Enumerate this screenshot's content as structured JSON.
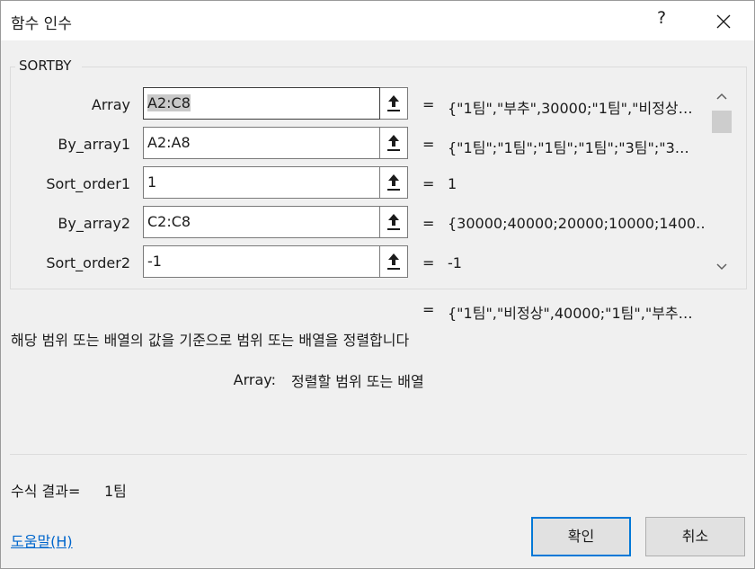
{
  "window": {
    "title": "함수 인수",
    "help_button": "?",
    "close_icon": "close-icon"
  },
  "group": {
    "title": "SORTBY"
  },
  "args": [
    {
      "label": "Array",
      "value": "A2:C8",
      "result": "{\"1팀\",\"부추\",30000;\"1팀\",\"비정상…"
    },
    {
      "label": "By_array1",
      "value": "A2:A8",
      "result": "{\"1팀\";\"1팀\";\"1팀\";\"1팀\";\"3팀\";\"3…"
    },
    {
      "label": "Sort_order1",
      "value": "1",
      "result": "1"
    },
    {
      "label": "By_array2",
      "value": "C2:C8",
      "result": "{30000;40000;20000;10000;1400…"
    },
    {
      "label": "Sort_order2",
      "value": "-1",
      "result": "-1"
    }
  ],
  "equals_sign": "=",
  "function_result": "{\"1팀\",\"비정상\",40000;\"1팀\",\"부추…",
  "description": "해당 범위 또는 배열의 값을 기준으로 범위 또는 배열을 정렬합니다",
  "arg_help": {
    "name": "Array:",
    "text": "정렬할 범위 또는 배열"
  },
  "formula_result": {
    "label": "수식 결과=",
    "value": "1팀"
  },
  "help_link": "도움말(H)",
  "buttons": {
    "ok": "확인",
    "cancel": "취소"
  }
}
